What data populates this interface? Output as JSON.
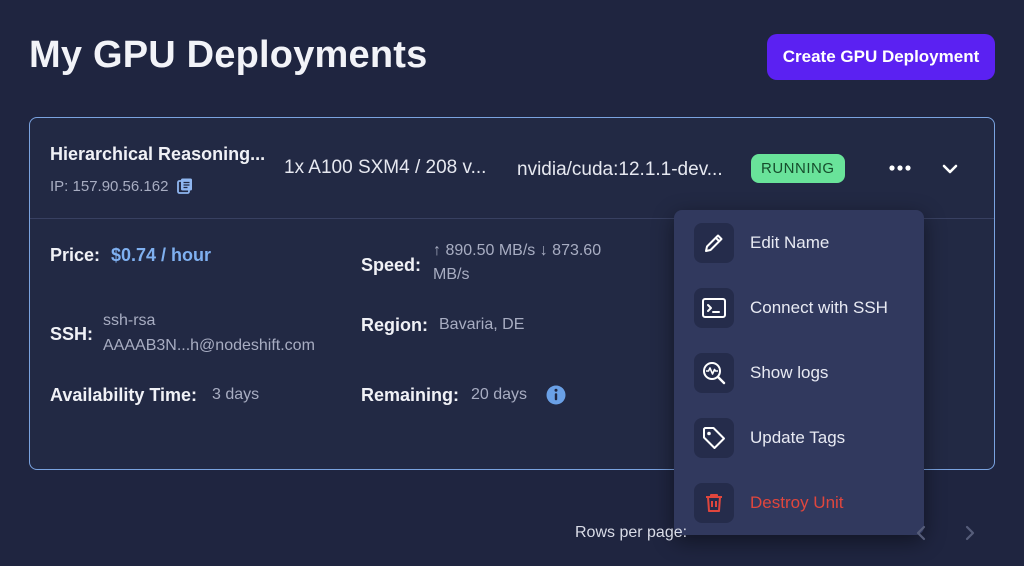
{
  "header": {
    "title": "My GPU Deployments",
    "create_button": "Create GPU Deployment"
  },
  "deployment": {
    "name": "Hierarchical Reasoning...",
    "ip": "IP: 157.90.56.162",
    "gpu": "1x A100 SXM4 / 208 v...",
    "image": "nvidia/cuda:12.1.1-dev...",
    "status": "RUNNING",
    "details": {
      "price_label": "Price:",
      "price_value": "$0.74 / hour",
      "speed_label": "Speed:",
      "speed_value_line1": "↑ 890.50 MB/s ↓ 873.60",
      "speed_value_line2": "MB/s",
      "ssh_label": "SSH:",
      "ssh_value_line1": "ssh-rsa",
      "ssh_value_line2": "AAAAB3N...h@nodeshift.com",
      "region_label": "Region:",
      "region_value": "Bavaria, DE",
      "availability_label": "Availability Time:",
      "availability_value": "3 days",
      "remaining_label": "Remaining:",
      "remaining_value": "20 days"
    }
  },
  "menu": {
    "items": [
      {
        "label": "Edit Name",
        "icon": "pencil-icon"
      },
      {
        "label": "Connect with SSH",
        "icon": "terminal-icon"
      },
      {
        "label": "Show logs",
        "icon": "log-search-icon"
      },
      {
        "label": "Update Tags",
        "icon": "tag-icon"
      },
      {
        "label": "Destroy Unit",
        "icon": "trash-icon"
      }
    ]
  },
  "pagination": {
    "rows_per_page_label": "Rows per page:"
  },
  "colors": {
    "background": "#1f2540",
    "accent": "#5b21f2",
    "card_border": "#7aa3e0",
    "status_running": "#69e39a",
    "price": "#7fb0f0",
    "danger": "#e0463d",
    "menu_bg": "#31395e"
  }
}
